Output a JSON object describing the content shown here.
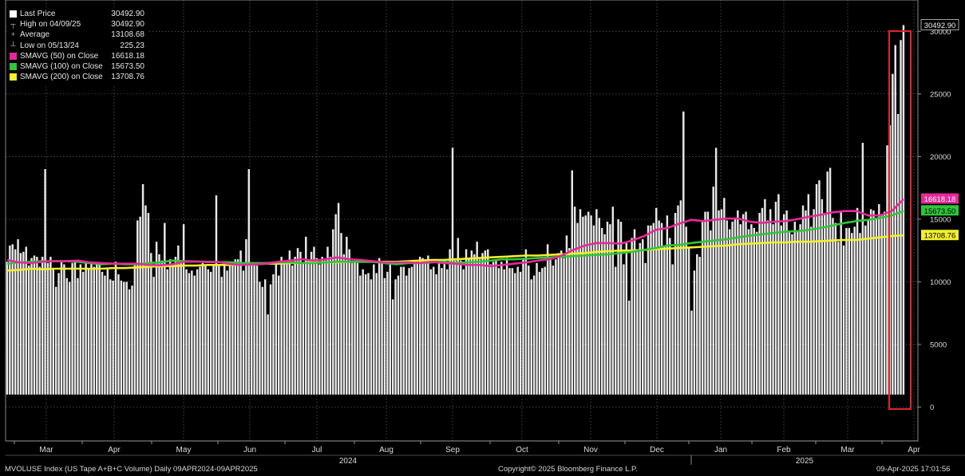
{
  "legend": {
    "last_price": {
      "label": "Last Price",
      "value": "30492.90",
      "color": "#ffffff"
    },
    "high": {
      "label": "High on 04/09/25",
      "value": "30492.90"
    },
    "average": {
      "label": "Average",
      "value": "13108.68"
    },
    "low": {
      "label": "Low on 05/13/24",
      "value": "225.23"
    },
    "sma50": {
      "label": "SMAVG (50)  on Close",
      "value": "16618.18",
      "color": "#e8289a"
    },
    "sma100": {
      "label": "SMAVG (100)  on Close",
      "value": "15673.50",
      "color": "#2fc63a"
    },
    "sma200": {
      "label": "SMAVG (200)  on Close",
      "value": "13708.76",
      "color": "#f2ef2c"
    }
  },
  "footer": {
    "left": "MVOLUSE Index (US Tape A+B+C Volume)  Daily 09APR2024-09APR2025",
    "center": "Copyright© 2025 Bloomberg Finance L.P.",
    "right": "09-Apr-2025 17:01:56"
  },
  "chart_data": {
    "type": "bar",
    "ylim": [
      -2700,
      32500
    ],
    "yticks": [
      "0",
      "5000",
      "10000",
      "15000",
      "20000",
      "25000",
      "30000"
    ],
    "ytick_values": [
      0,
      5000,
      10000,
      15000,
      20000,
      25000,
      30000
    ],
    "month_labels": [
      "Mar",
      "Apr",
      "May",
      "Jun",
      "Jul",
      "Aug",
      "Sep",
      "Oct",
      "Nov",
      "Dec",
      "Jan",
      "Feb",
      "Mar",
      "Apr"
    ],
    "year_labels": [
      "2024",
      "2025"
    ],
    "grid": true,
    "highlight_color": "#e0262b",
    "value_labels": [
      "30492.90",
      "16618.18",
      "15673.50",
      "13708.76"
    ],
    "volume_values": [
      11600,
      12900,
      13000,
      12600,
      13400,
      12300,
      12400,
      12800,
      11300,
      11900,
      12100,
      12000,
      11200,
      12000,
      19000,
      11500,
      12000,
      11100,
      9600,
      10700,
      11600,
      11400,
      10300,
      10000,
      11500,
      11700,
      10300,
      11400,
      10800,
      11500,
      11100,
      11600,
      11200,
      11500,
      11400,
      10800,
      10500,
      11000,
      10200,
      10100,
      11600,
      10600,
      10100,
      10000,
      10000,
      9400,
      9700,
      11500,
      14900,
      15200,
      17800,
      16100,
      15500,
      12300,
      10400,
      13200,
      12200,
      11700,
      14700,
      11000,
      11800,
      11300,
      12000,
      12900,
      11500,
      14600,
      11000,
      10700,
      10900,
      10500,
      11000,
      11200,
      11500,
      11300,
      11000,
      10800,
      11400,
      16900,
      11300,
      10400,
      11600,
      10900,
      11500,
      11600,
      11800,
      11800,
      12500,
      10900,
      13400,
      19000,
      11500,
      11300,
      11300,
      10000,
      9600,
      10200,
      7400,
      9800,
      10600,
      11600,
      10500,
      12000,
      11500,
      11400,
      12500,
      11300,
      12000,
      12700,
      12400,
      11500,
      13600,
      11700,
      12400,
      12800,
      11900,
      11400,
      12000,
      11700,
      12800,
      12000,
      14200,
      15400,
      16300,
      13900,
      12200,
      13600,
      12600,
      11500,
      11700,
      11500,
      10500,
      11000,
      10600,
      10700,
      10200,
      11400,
      10700,
      11900,
      11600,
      10300,
      10800,
      11400,
      8600,
      10200,
      10500,
      11200,
      11200,
      10500,
      11100,
      11200,
      11700,
      11500,
      12000,
      11900,
      11800,
      12100,
      11000,
      11200,
      10600,
      11600,
      11100,
      11800,
      11000,
      12600,
      20700,
      11700,
      13500,
      11700,
      11000,
      12600,
      11900,
      12500,
      12200,
      13200,
      11800,
      12300,
      12500,
      12600,
      11400,
      11600,
      11800,
      11100,
      11600,
      11000,
      11900,
      11100,
      11100,
      10700,
      11200,
      10800,
      11800,
      12600,
      11300,
      10200,
      10500,
      11500,
      10800,
      11100,
      11200,
      13000,
      12000,
      11300,
      11800,
      12300,
      12500,
      11900,
      13700,
      12700,
      18900,
      16000,
      14700,
      15800,
      15200,
      15300,
      15600,
      15300,
      14500,
      15800,
      15100,
      14300,
      13800,
      14800,
      14600,
      16000,
      11200,
      15000,
      14800,
      11400,
      13100,
      8500,
      13500,
      14200,
      12500,
      13100,
      13400,
      11500,
      14500,
      14500,
      14700,
      15900,
      14900,
      14700,
      12900,
      15300,
      13500,
      11400,
      15500,
      16100,
      16500,
      23600,
      14400,
      12700,
      7700,
      10900,
      12200,
      12000,
      14800,
      15600,
      15600,
      14100,
      17600,
      20700,
      15700,
      15800,
      16700,
      14900,
      14200,
      14800,
      15000,
      15700,
      14600,
      15400,
      15600,
      14200,
      14600,
      14300,
      14000,
      15500,
      15900,
      16600,
      14900,
      15800,
      14600,
      16400,
      17000,
      14500,
      15400,
      15700,
      14100,
      13800,
      14800,
      14100,
      14600,
      16100,
      15700,
      17000,
      14400,
      15800,
      17800,
      18100,
      16600,
      15500,
      18800,
      19100,
      15100,
      14700,
      13200,
      15700,
      12900,
      14300,
      14300,
      13900,
      14400,
      15900,
      13900,
      21100,
      14500,
      14900,
      15800,
      15700,
      15000,
      16200,
      15300,
      15600,
      20900,
      22500,
      26600,
      28900,
      23400,
      29300,
      30500
    ],
    "sma50_values": [
      11750,
      11550,
      11500,
      11600,
      11650,
      11650,
      11700,
      11550,
      11500,
      11450,
      11450,
      11450,
      11350,
      11320,
      11400,
      11600,
      11620,
      11580,
      11580,
      11400,
      11350,
      11400,
      11450,
      11600,
      11700,
      11800,
      11700,
      11800,
      11950,
      11800,
      11750,
      11650,
      11550,
      11550,
      11550,
      11500,
      11600,
      11500,
      11450,
      11350,
      11350,
      11250,
      11350,
      11450,
      11550,
      11700,
      11800,
      12100,
      12550,
      12900,
      13100,
      13100,
      13050,
      13300,
      13650,
      14150,
      14300,
      14650,
      14950,
      14850,
      14950,
      15050,
      15050,
      14800,
      14700,
      14800,
      14850,
      15000,
      15200,
      15350,
      15550,
      15650,
      15650,
      15300,
      15300,
      15650,
      16600
    ],
    "sma100_values": [
      11450,
      11550,
      11600,
      11650,
      11650,
      11650,
      11600,
      11500,
      11400,
      11450,
      11400,
      11400,
      11500,
      11550,
      11700,
      11650,
      11620,
      11600,
      11580,
      11550,
      11500,
      11500,
      11500,
      11550,
      11550,
      11500,
      11500,
      11550,
      11600,
      11600,
      11600,
      11600,
      11500,
      11400,
      11500,
      11500,
      11550,
      11600,
      11500,
      11550,
      11600,
      11700,
      11800,
      11800,
      11850,
      11900,
      11950,
      12000,
      12050,
      12100,
      12150,
      12200,
      12300,
      12400,
      12550,
      12700,
      12900,
      12950,
      13100,
      13200,
      13300,
      13400,
      13550,
      13700,
      13800,
      13900,
      14000,
      14050,
      14150,
      14300,
      14500,
      14700,
      14850,
      14950,
      15100,
      15300,
      15650
    ],
    "sma200_values": [
      10900,
      10950,
      11050,
      11000,
      11050,
      11050,
      11050,
      11050,
      11050,
      11100,
      11100,
      11150,
      11200,
      11250,
      11250,
      11300,
      11300,
      11350,
      11350,
      11350,
      11400,
      11400,
      11450,
      11450,
      11500,
      11500,
      11550,
      11550,
      11550,
      11600,
      11600,
      11600,
      11600,
      11600,
      11650,
      11700,
      11750,
      11750,
      11800,
      11850,
      11900,
      11950,
      12000,
      12050,
      12100,
      12100,
      12150,
      12200,
      12250,
      12300,
      12400,
      12450,
      12500,
      12500,
      12550,
      12600,
      12650,
      12700,
      12750,
      12800,
      12850,
      12900,
      13000,
      13050,
      13100,
      13150,
      13150,
      13200,
      13200,
      13250,
      13300,
      13350,
      13350,
      13450,
      13550,
      13650,
      13710
    ]
  }
}
